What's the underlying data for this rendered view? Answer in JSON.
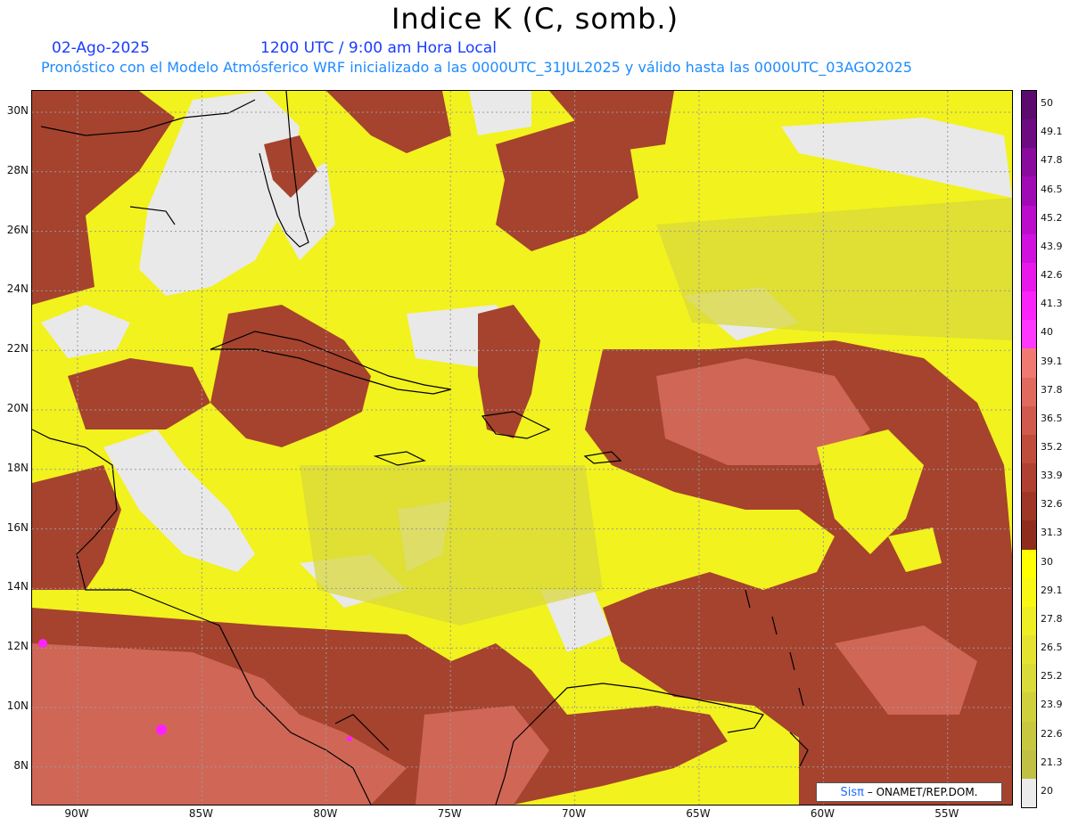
{
  "header": {
    "title": "Indice K (C, somb.)",
    "date": "02-Ago-2025",
    "time": "1200 UTC / 9:00 am Hora Local",
    "subtitle": "Pronóstico con el Modelo Atmósferico WRF inicializado a las 0000UTC_31JUL2025 y válido hasta las  0000UTC_03AGO2025"
  },
  "map": {
    "lat_labels": [
      "30N",
      "28N",
      "26N",
      "24N",
      "22N",
      "20N",
      "18N",
      "16N",
      "14N",
      "12N",
      "10N",
      "8N"
    ],
    "lon_labels": [
      "90W",
      "85W",
      "80W",
      "75W",
      "70W",
      "65W",
      "60W",
      "55W"
    ],
    "colors": {
      "gray": "#e9e9e9",
      "yellow_pale": "#dede3a",
      "yellow": "#f4f41c",
      "yellow_bright": "#ffff00",
      "brown_dark": "#8b2d1e",
      "brown": "#a5432e",
      "red": "#c85a4a",
      "pink": "#e07a6a",
      "magenta": "#ff00ff"
    }
  },
  "colorbar": {
    "labels": [
      "50",
      "49.1",
      "47.8",
      "46.5",
      "45.2",
      "43.9",
      "42.6",
      "41.3",
      "40",
      "39.1",
      "37.8",
      "36.5",
      "35.2",
      "33.9",
      "32.6",
      "31.3",
      "30",
      "29.1",
      "27.8",
      "26.5",
      "25.2",
      "23.9",
      "22.6",
      "21.3",
      "20"
    ],
    "colors": [
      "#5c0a6e",
      "#6e0a82",
      "#8a0a9e",
      "#a00ab5",
      "#bb0ccc",
      "#d010de",
      "#e818ec",
      "#f824f8",
      "#ff38ff",
      "#f07a72",
      "#e06a5e",
      "#d05a4c",
      "#c04c3c",
      "#b0402f",
      "#a03626",
      "#8f2c1e",
      "#ffff00",
      "#f8f814",
      "#eeee24",
      "#e4e430",
      "#dada38",
      "#d0d03c",
      "#c8c840",
      "#c0c044",
      "#ebebeb"
    ]
  },
  "credit": {
    "brand": "Sisπ",
    "text": "– ONAMET/REP.DOM."
  }
}
